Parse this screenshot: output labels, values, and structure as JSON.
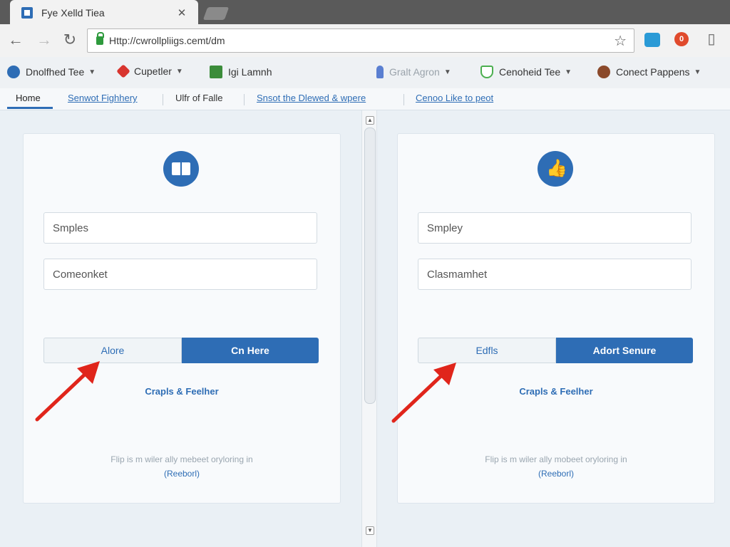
{
  "browser": {
    "tab_title": "Fye Xelld Tiea",
    "tab_close": "✕",
    "url": "Http://cwrollpliigs.cemt/dm",
    "ext_badge": "0"
  },
  "bookmarks": [
    {
      "label": "Dnolfhed Tee",
      "color": "#2e6db5",
      "caret": true
    },
    {
      "label": "Cupetler",
      "color": "#d8352f",
      "caret": true
    },
    {
      "label": "Igi Lamnh",
      "color": "#3b8c3a",
      "caret": false
    },
    {
      "label": "Gralt Agron",
      "color": "#5a7fd1",
      "caret": true
    },
    {
      "label": "Cenoheid Tee",
      "color": "#4caf50",
      "caret": true
    },
    {
      "label": "Conect Pappens",
      "color": "#8b4a2b",
      "caret": true
    }
  ],
  "subnav": {
    "home": "Home",
    "link1": "Senwot Fighhery",
    "link2": "Ulfr of Falle",
    "link3": "Snsot the Dlewed & wpere",
    "link4": "Cenoo Like to peot"
  },
  "panels": [
    {
      "icon": "book-icon",
      "field1": "Smples",
      "field2": "Comeonket",
      "btn_light": "Alore",
      "btn_primary": "Cn Here",
      "link": "Crapls & Feelher",
      "footer": "Flip is m wiler ally mebeet oryloring in",
      "footer_link": "(Reeborl)"
    },
    {
      "icon": "thumbs-up-icon",
      "field1": "Smpley",
      "field2": "Clasmamhet",
      "btn_light": "Edfls",
      "btn_primary": "Adort Senure",
      "link": "Crapls & Feelher",
      "footer": "Flip is m wiler ally mobeet oryloring in",
      "footer_link": "(Reeborl)"
    }
  ],
  "colors": {
    "accent": "#2e6db5",
    "arrow": "#e0251b"
  }
}
